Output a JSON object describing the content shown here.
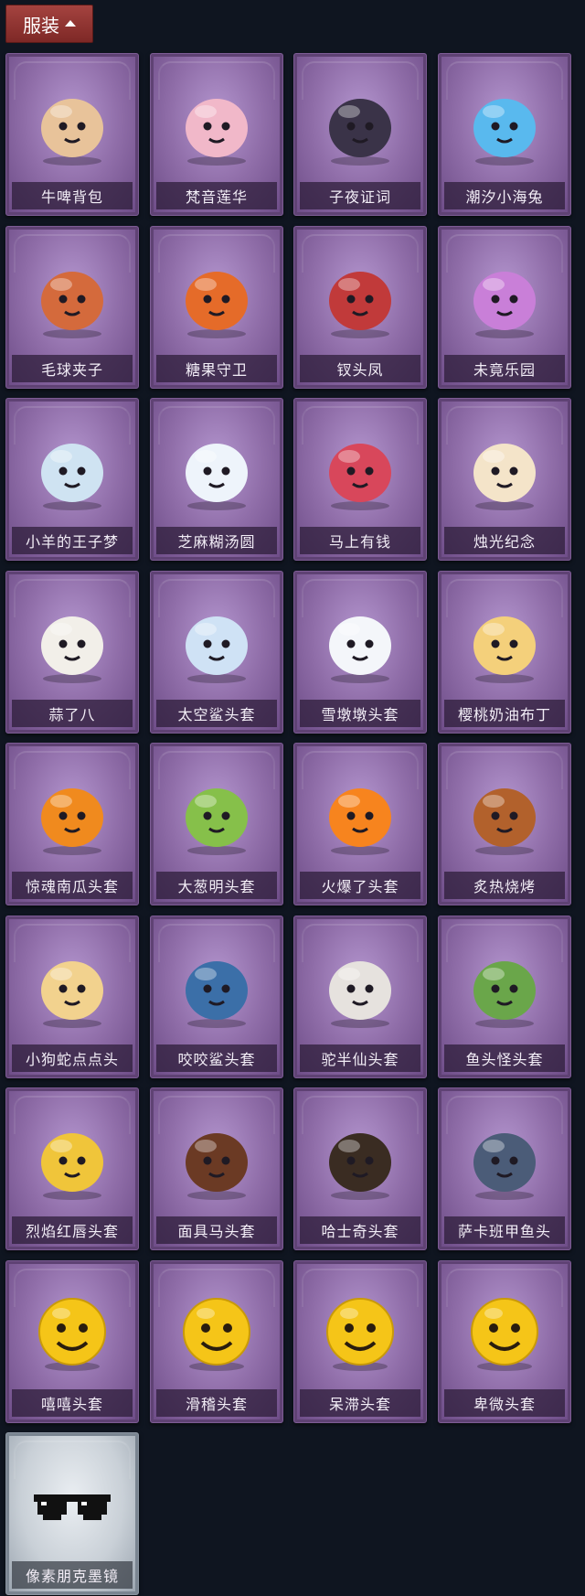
{
  "header": {
    "title": "服装"
  },
  "items": [
    {
      "label": "牛啤背包",
      "icon": "cow-beer-backpack-icon",
      "color": "#e8c39a"
    },
    {
      "label": "梵音莲华",
      "icon": "lotus-fairy-icon",
      "color": "#f1b8c9"
    },
    {
      "label": "子夜证词",
      "icon": "midnight-testimony-icon",
      "color": "#3a3348"
    },
    {
      "label": "潮汐小海兔",
      "icon": "tide-sea-bunny-icon",
      "color": "#59b9ee"
    },
    {
      "label": "毛球夹子",
      "icon": "red-panda-clip-icon",
      "color": "#d46a3c"
    },
    {
      "label": "糖果守卫",
      "icon": "candy-guard-icon",
      "color": "#e56b29"
    },
    {
      "label": "钗头凤",
      "icon": "phoenix-hairpin-icon",
      "color": "#c13a3a"
    },
    {
      "label": "未竟乐园",
      "icon": "unfinished-paradise-icon",
      "color": "#c97fd8"
    },
    {
      "label": "小羊的王子梦",
      "icon": "lamb-prince-icon",
      "color": "#cfe3f2"
    },
    {
      "label": "芝麻糊汤圆",
      "icon": "sesame-dumpling-icon",
      "color": "#eef4fb"
    },
    {
      "label": "马上有钱",
      "icon": "horse-money-icon",
      "color": "#d8475b"
    },
    {
      "label": "烛光纪念",
      "icon": "candle-icon",
      "color": "#f4e4c9"
    },
    {
      "label": "蒜了八",
      "icon": "garlic-icon",
      "color": "#f2efe9"
    },
    {
      "label": "太空鲨头套",
      "icon": "space-shark-icon",
      "color": "#cfe2f5"
    },
    {
      "label": "雪墩墩头套",
      "icon": "snowman-icon",
      "color": "#f4f6fa"
    },
    {
      "label": "樱桃奶油布丁",
      "icon": "cherry-pudding-icon",
      "color": "#f4d07b"
    },
    {
      "label": "惊魂南瓜头套",
      "icon": "pumpkin-icon",
      "color": "#f08a1e"
    },
    {
      "label": "大葱明头套",
      "icon": "green-onion-icon",
      "color": "#86c04a"
    },
    {
      "label": "火爆了头套",
      "icon": "fire-spirit-icon",
      "color": "#f7841e"
    },
    {
      "label": "炙热烧烤",
      "icon": "bbq-meat-icon",
      "color": "#b2612c"
    },
    {
      "label": "小狗蛇点点头",
      "icon": "dog-snake-icon",
      "color": "#f2d28e"
    },
    {
      "label": "咬咬鲨头套",
      "icon": "biting-shark-icon",
      "color": "#3b6fa8"
    },
    {
      "label": "驼半仙头套",
      "icon": "bear-sunglasses-icon",
      "color": "#e6e2de"
    },
    {
      "label": "鱼头怪头套",
      "icon": "fish-head-icon",
      "color": "#6aa64a"
    },
    {
      "label": "烈焰红唇头套",
      "icon": "red-lips-icon",
      "color": "#f0c53a"
    },
    {
      "label": "面具马头套",
      "icon": "horse-mask-icon",
      "color": "#6b3a24"
    },
    {
      "label": "哈士奇头套",
      "icon": "husky-icon",
      "color": "#3a2c22"
    },
    {
      "label": "萨卡班甲鱼头",
      "icon": "sacabambaspis-icon",
      "color": "#4b5c78"
    },
    {
      "label": "嘻嘻头套",
      "icon": "grin-emoji-icon",
      "color": "#f5c518"
    },
    {
      "label": "滑稽头套",
      "icon": "funny-emoji-icon",
      "color": "#f5c518"
    },
    {
      "label": "呆滞头套",
      "icon": "dazed-emoji-icon",
      "color": "#f5c518"
    },
    {
      "label": "卑微头套",
      "icon": "humble-emoji-icon",
      "color": "#f5c518"
    },
    {
      "label": "像素朋克墨镜",
      "icon": "pixel-sunglasses-icon",
      "color": "#111111",
      "variant": "silver"
    }
  ]
}
